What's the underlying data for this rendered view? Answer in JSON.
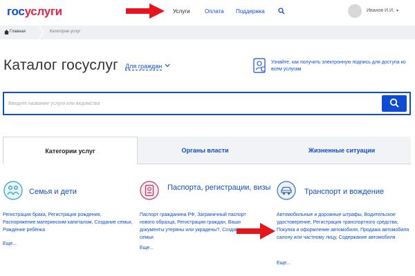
{
  "header": {
    "logo_part1": "гос",
    "logo_part2": "услуги",
    "nav": [
      {
        "label": "Услуги"
      },
      {
        "label": "Оплата"
      },
      {
        "label": "Поддержка"
      }
    ],
    "user_name": "Иванов И.И.",
    "user_caret": "▾"
  },
  "breadcrumb": {
    "home": "Главная",
    "current": "Категории услуг"
  },
  "page": {
    "title": "Каталог госуслуг",
    "for_whom": "Для граждан",
    "signature_link": "Узнайте, как получить электронную подпись для доступа ко всем услугам"
  },
  "search": {
    "placeholder": "Введите название услуги или ведомства"
  },
  "tabs": [
    {
      "label": "Категории услуг"
    },
    {
      "label": "Органы власти"
    },
    {
      "label": "Жизненные ситуации"
    }
  ],
  "categories": [
    {
      "title": "Семья и дети",
      "links": "Регистрация брака, Регистрация рождения, Распоряжение материнским капиталом, Создание семьи, Рождение ребёнка",
      "more": "Еще..."
    },
    {
      "title": "Паспорта, регистрации, визы",
      "links": "Паспорт гражданина РФ, Заграничный паспорт нового образца, Регистрация граждан, Ваши документы утеряны или украдены?, Создание семьи",
      "more": "Еще..."
    },
    {
      "title": "Транспорт и вождение",
      "links": "Автомобильные и дорожные штрафы, Водительское удостоверение, Регистрация транспортного средства, Покупка и оформление автомобиля, Продажа автомобиля салону или частному лицу, Содержание автомобиля",
      "more": "Еще..."
    }
  ],
  "colors": {
    "brand_blue": "#0d4cd3",
    "brand_red": "#e4254a",
    "annotation_red": "#e8141c",
    "icon_teal": "#2ba3b8",
    "icon_pink": "#c2325d",
    "icon_steel": "#3b6ea8"
  }
}
